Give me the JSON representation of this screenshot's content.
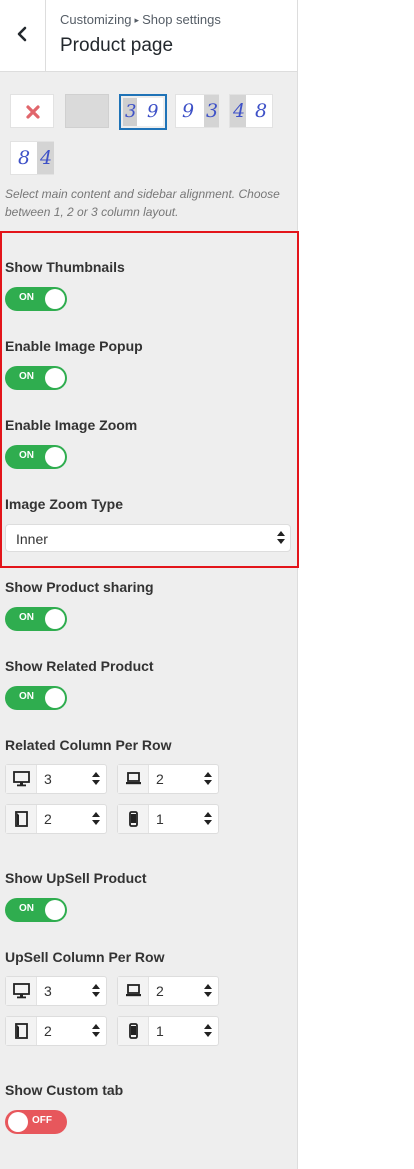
{
  "header": {
    "breadcrumb_root": "Customizing",
    "breadcrumb_separator": "▸",
    "breadcrumb_section": "Shop settings",
    "title": "Product page"
  },
  "layouts": [
    {
      "name": "no-sidebar"
    },
    {
      "name": "full-width"
    },
    {
      "name": "left-sidebar",
      "digits": "3 9",
      "selected": true
    },
    {
      "name": "right-sidebar",
      "digits": "9 3"
    },
    {
      "name": "two-col",
      "digits": "4 8"
    },
    {
      "name": "two-col-reverse",
      "digits": "8 4"
    }
  ],
  "layout_description": "Select main content and sidebar alignment. Choose between 1, 2 or 3 column layout.",
  "settings": {
    "show_thumbnails": {
      "label": "Show Thumbnails",
      "state": "ON"
    },
    "image_popup": {
      "label": "Enable Image Popup",
      "state": "ON"
    },
    "image_zoom": {
      "label": "Enable Image Zoom",
      "state": "ON"
    },
    "zoom_type": {
      "label": "Image Zoom Type",
      "value": "Inner"
    },
    "product_sharing": {
      "label": "Show Product sharing",
      "state": "ON"
    },
    "related_product": {
      "label": "Show Related Product",
      "state": "ON"
    },
    "related_columns": {
      "label": "Related Column Per Row",
      "desktop": "3",
      "laptop": "2",
      "tablet": "2",
      "mobile": "1"
    },
    "upsell_product": {
      "label": "Show UpSell Product",
      "state": "ON"
    },
    "upsell_columns": {
      "label": "UpSell Column Per Row",
      "desktop": "3",
      "laptop": "2",
      "tablet": "2",
      "mobile": "1"
    },
    "custom_tab": {
      "label": "Show Custom tab",
      "state": "OFF"
    }
  },
  "colors": {
    "toggle_on": "#2fad4f",
    "toggle_off": "#e7575c",
    "highlight_border": "#e3141a",
    "layout_digit": "#3e51c7",
    "selected_outline": "#1f73b7"
  }
}
